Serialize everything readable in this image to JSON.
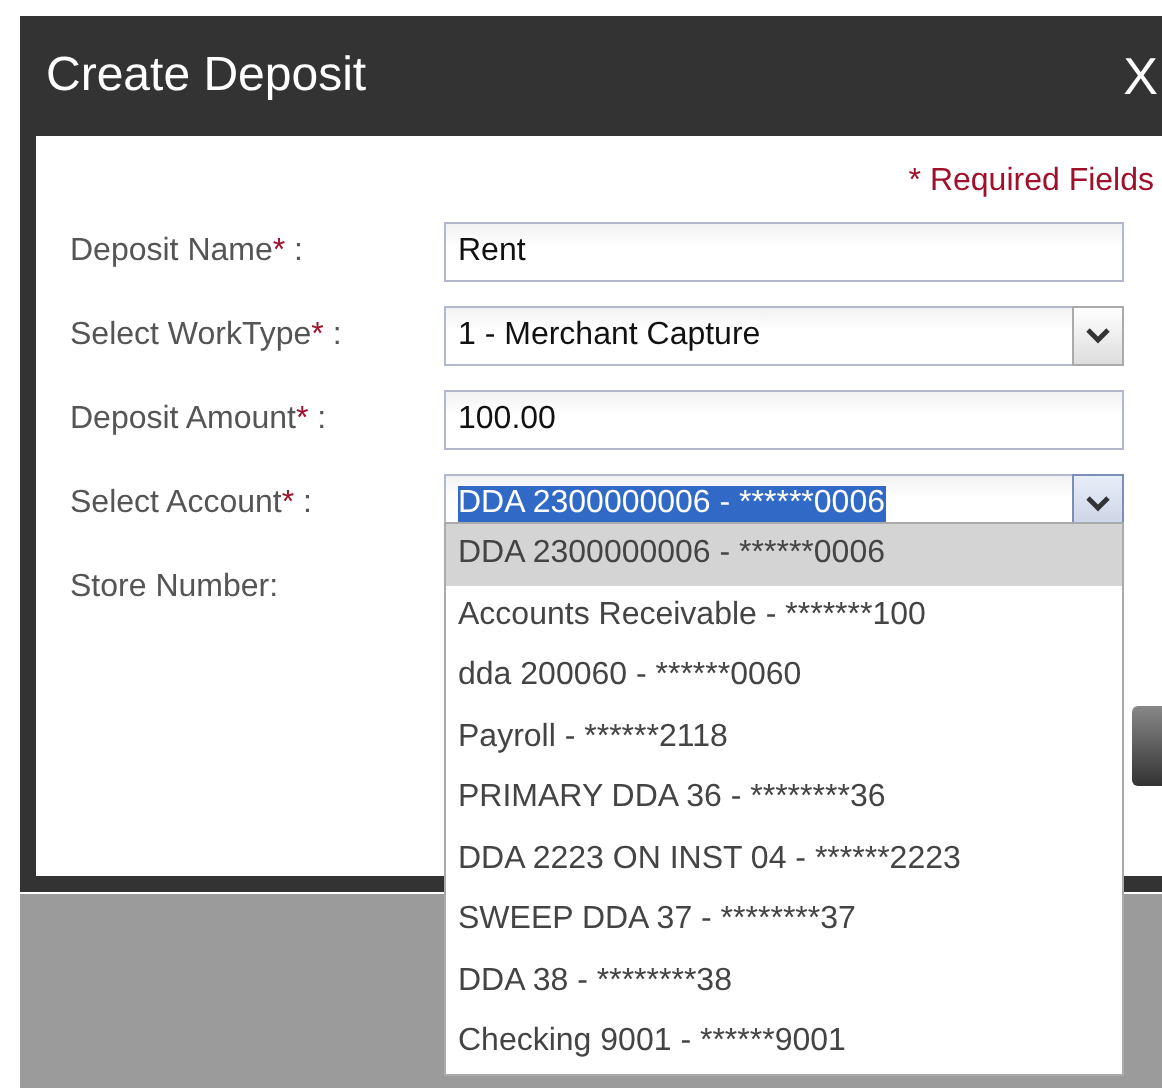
{
  "dialog": {
    "title": "Create Deposit",
    "close": "X"
  },
  "required_note": "* Required Fields",
  "fields": [
    {
      "label": "Deposit Name",
      "mark": "*",
      "suffix": " :",
      "kind": "text",
      "value": "Rent"
    },
    {
      "label": "Select WorkType",
      "mark": "*",
      "suffix": " :",
      "kind": "select",
      "value": "1 - Merchant Capture",
      "value_selected": false,
      "open": false
    },
    {
      "label": "Deposit Amount",
      "mark": "*",
      "suffix": " :",
      "kind": "text",
      "value": "100.00"
    },
    {
      "label": "Select Account",
      "mark": "*",
      "suffix": " :",
      "kind": "select",
      "value": "DDA 2300000006 - ******0006",
      "value_selected": true,
      "open": true,
      "options": [
        {
          "label": "DDA 2300000006 - ******0006",
          "selected": true
        },
        {
          "label": "Accounts Receivable - *******100",
          "selected": false
        },
        {
          "label": "dda 200060 - ******0060",
          "selected": false
        },
        {
          "label": "Payroll - ******2118",
          "selected": false
        },
        {
          "label": "PRIMARY DDA 36 - ********36",
          "selected": false
        },
        {
          "label": "DDA 2223 ON INST 04 - ******2223",
          "selected": false
        },
        {
          "label": "SWEEP DDA 37 - ********37",
          "selected": false
        },
        {
          "label": "DDA 38 - ********38",
          "selected": false
        },
        {
          "label": "Checking 9001 - ******9001",
          "selected": false
        }
      ]
    },
    {
      "label": "Store Number:",
      "kind": "hidden"
    }
  ]
}
